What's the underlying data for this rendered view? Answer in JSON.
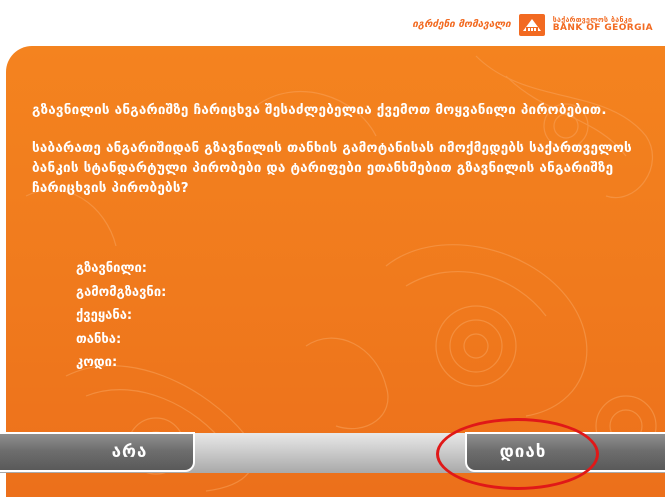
{
  "header": {
    "tagline": "იგრძენი მომავალი",
    "logo_geo": "საქართველოს ბანკი",
    "logo_en": "BANK OF GEORGIA"
  },
  "message": {
    "line_1": "გზავნილის ანგარიშზე ჩარიცხვა შესაძლებელია ქვემოთ მოყვანილი პირობებით.",
    "line_2": "საბარათე ანგარიშიდან გზავნილის თანხის გამოტანისას იმოქმედებს საქართველოს ბანკის სტანდარტული პირობები და ტარიფები ეთანხმებით გზავნილის ანგარიშზე ჩარიცხვის პირობებს?"
  },
  "fields": {
    "transfer": "გზავნილი:",
    "sender": "გამომგზავნი:",
    "country": "ქვეყანა:",
    "amount": "თანხა:",
    "code": "კოდი:"
  },
  "buttons": {
    "no": "არა",
    "yes": "დიახ"
  },
  "colors": {
    "brand_orange": "#f26a21",
    "panel_orange": "#f4831f",
    "highlight_red": "#e01818"
  }
}
